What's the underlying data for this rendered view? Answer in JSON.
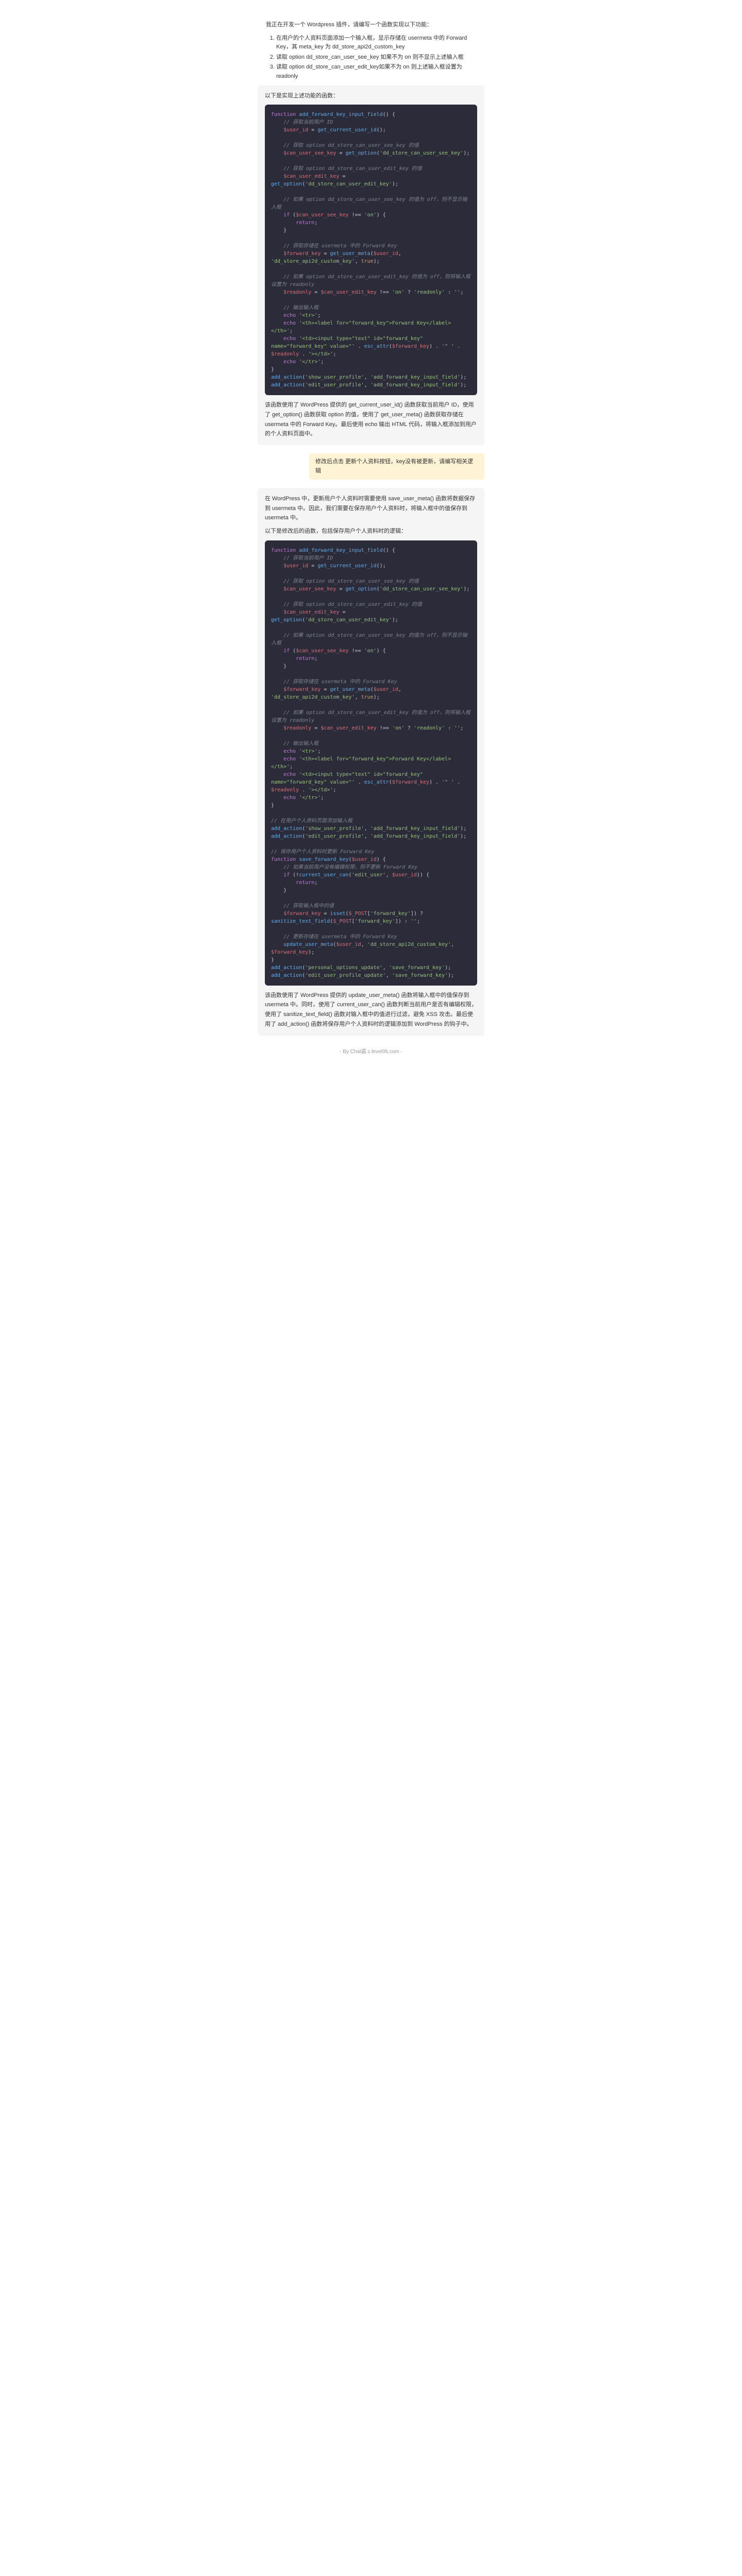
{
  "intro": {
    "title": "我正在开发一个 Wordpress 插件，请编写一个函数实现以下功能：",
    "items": [
      "在用户的个人资料页面添加一个输入框，显示存储在 usermeta 中的 Forward Key，其 meta_key 为 dd_store_api2d_custom_key",
      "读取 option dd_store_can_user_see_key 如果不为 on 则不显示上述输入框",
      "读取 option dd_store_can_user_edit_key如果不为 on 则上述输入框设置为 readonly"
    ]
  },
  "block1": {
    "title": "以下是实现上述功能的函数：",
    "after": "该函数使用了 WordPress 提供的 get_current_user_id() 函数获取当前用户 ID，使用了 get_option() 函数获取 option 的值，使用了 get_user_meta() 函数获取存储在 usermeta 中的 Forward Key。最后使用 echo 输出 HTML 代码，将输入框添加到用户的个人资料页面中。"
  },
  "prompt2": "修改后点击 更新个人资料按钮，key没有被更新，请编写相关逻辑",
  "block2": {
    "pre": "在 WordPress 中，更新用户个人资料时需要使用 save_user_meta() 函数将数据保存到 usermeta 中。因此，我们需要在保存用户个人资料时，将输入框中的值保存到 usermeta 中。",
    "pre2": "以下是修改后的函数，包括保存用户个人资料时的逻辑：",
    "after": "该函数使用了 WordPress 提供的 update_user_meta() 函数将输入框中的值保存到 usermeta 中。同时，使用了 current_user_can() 函数判断当前用户是否有编辑权限，使用了 sanitize_text_field() 函数对输入框中的值进行过滤，避免 XSS 攻击。最后使用了 add_action() 函数将保存用户个人资料时的逻辑添加到 WordPress 的钩子中。"
  },
  "footer": "- By Chat酱 c.level06.com -",
  "code1_lines": [
    {
      "t": "kw",
      "v": "function"
    },
    {
      "t": "plain",
      "v": " "
    },
    {
      "t": "fn",
      "v": "add_forward_key_input_field"
    },
    {
      "t": "plain",
      "v": "() {"
    },
    "\n    ",
    {
      "t": "cm",
      "v": "// 获取当前用户 ID"
    },
    "\n    ",
    {
      "t": "var",
      "v": "$user_id"
    },
    {
      "t": "plain",
      "v": " = "
    },
    {
      "t": "fn",
      "v": "get_current_user_id"
    },
    {
      "t": "plain",
      "v": "();"
    },
    "\n",
    "\n    ",
    {
      "t": "cm",
      "v": "// 获取 option dd_store_can_user_see_key 的值"
    },
    "\n    ",
    {
      "t": "var",
      "v": "$can_user_see_key"
    },
    {
      "t": "plain",
      "v": " = "
    },
    {
      "t": "fn",
      "v": "get_option"
    },
    {
      "t": "plain",
      "v": "("
    },
    {
      "t": "str",
      "v": "'dd_store_can_user_see_key'"
    },
    {
      "t": "plain",
      "v": ");"
    },
    "\n",
    "\n    ",
    {
      "t": "cm",
      "v": "// 获取 option dd_store_can_user_edit_key 的值"
    },
    "\n    ",
    {
      "t": "var",
      "v": "$can_user_edit_key"
    },
    {
      "t": "plain",
      "v": " = "
    },
    {
      "t": "fn",
      "v": "get_option"
    },
    {
      "t": "plain",
      "v": "("
    },
    {
      "t": "str",
      "v": "'dd_store_can_user_edit_key'"
    },
    {
      "t": "plain",
      "v": ");"
    },
    "\n",
    "\n    ",
    {
      "t": "cm",
      "v": "// 如果 option dd_store_can_user_see_key 的值为 off，则不显示输入框"
    },
    "\n    ",
    {
      "t": "kw",
      "v": "if"
    },
    {
      "t": "plain",
      "v": " ("
    },
    {
      "t": "var",
      "v": "$can_user_see_key"
    },
    {
      "t": "plain",
      "v": " !== "
    },
    {
      "t": "str",
      "v": "'on'"
    },
    {
      "t": "plain",
      "v": ") {"
    },
    "\n        ",
    {
      "t": "kw",
      "v": "return"
    },
    {
      "t": "plain",
      "v": ";"
    },
    "\n    ",
    {
      "t": "plain",
      "v": "}"
    },
    "\n",
    "\n    ",
    {
      "t": "cm",
      "v": "// 获取存储在 usermeta 中的 Forward Key"
    },
    "\n    ",
    {
      "t": "var",
      "v": "$forward_key"
    },
    {
      "t": "plain",
      "v": " = "
    },
    {
      "t": "fn",
      "v": "get_user_meta"
    },
    {
      "t": "plain",
      "v": "("
    },
    {
      "t": "var",
      "v": "$user_id"
    },
    {
      "t": "plain",
      "v": ", "
    },
    {
      "t": "str",
      "v": "'dd_store_api2d_custom_key'"
    },
    {
      "t": "plain",
      "v": ", "
    },
    {
      "t": "bool",
      "v": "true"
    },
    {
      "t": "plain",
      "v": ");"
    },
    "\n",
    "\n    ",
    {
      "t": "cm",
      "v": "// 如果 option dd_store_can_user_edit_key 的值为 off，则将输入框设置为 readonly"
    },
    "\n    ",
    {
      "t": "var",
      "v": "$readonly"
    },
    {
      "t": "plain",
      "v": " = "
    },
    {
      "t": "var",
      "v": "$can_user_edit_key"
    },
    {
      "t": "plain",
      "v": " !== "
    },
    {
      "t": "str",
      "v": "'on'"
    },
    {
      "t": "plain",
      "v": " ? "
    },
    {
      "t": "str",
      "v": "'readonly'"
    },
    {
      "t": "plain",
      "v": " : "
    },
    {
      "t": "str",
      "v": "''"
    },
    {
      "t": "plain",
      "v": ";"
    },
    "\n",
    "\n    ",
    {
      "t": "cm",
      "v": "// 输出输入框"
    },
    "\n    ",
    {
      "t": "kw",
      "v": "echo"
    },
    {
      "t": "plain",
      "v": " "
    },
    {
      "t": "str",
      "v": "'<tr>'"
    },
    {
      "t": "plain",
      "v": ";"
    },
    "\n    ",
    {
      "t": "kw",
      "v": "echo"
    },
    {
      "t": "plain",
      "v": " "
    },
    {
      "t": "str",
      "v": "'<th><label for=\"forward_key\">Forward Key</label></th>'"
    },
    {
      "t": "plain",
      "v": ";"
    },
    "\n    ",
    {
      "t": "kw",
      "v": "echo"
    },
    {
      "t": "plain",
      "v": " "
    },
    {
      "t": "str",
      "v": "'<td><input type=\"text\" id=\"forward_key\" name=\"forward_key\" value=\"'"
    },
    {
      "t": "plain",
      "v": " . "
    },
    {
      "t": "fn",
      "v": "esc_attr"
    },
    {
      "t": "plain",
      "v": "("
    },
    {
      "t": "var",
      "v": "$forward_key"
    },
    {
      "t": "plain",
      "v": ") . "
    },
    {
      "t": "str",
      "v": "'\" '"
    },
    {
      "t": "plain",
      "v": " . "
    },
    {
      "t": "var",
      "v": "$readonly"
    },
    {
      "t": "plain",
      "v": " . "
    },
    {
      "t": "str",
      "v": "'></td>'"
    },
    {
      "t": "plain",
      "v": ";"
    },
    "\n    ",
    {
      "t": "kw",
      "v": "echo"
    },
    {
      "t": "plain",
      "v": " "
    },
    {
      "t": "str",
      "v": "'</tr>'"
    },
    {
      "t": "plain",
      "v": ";"
    },
    "\n",
    {
      "t": "plain",
      "v": "}"
    },
    "\n",
    {
      "t": "fn",
      "v": "add_action"
    },
    {
      "t": "plain",
      "v": "("
    },
    {
      "t": "str",
      "v": "'show_user_profile'"
    },
    {
      "t": "plain",
      "v": ", "
    },
    {
      "t": "str",
      "v": "'add_forward_key_input_field'"
    },
    {
      "t": "plain",
      "v": ");"
    },
    "\n",
    {
      "t": "fn",
      "v": "add_action"
    },
    {
      "t": "plain",
      "v": "("
    },
    {
      "t": "str",
      "v": "'edit_user_profile'"
    },
    {
      "t": "plain",
      "v": ", "
    },
    {
      "t": "str",
      "v": "'add_forward_key_input_field'"
    },
    {
      "t": "plain",
      "v": ");"
    }
  ],
  "code2_lines": [
    {
      "t": "kw",
      "v": "function"
    },
    {
      "t": "plain",
      "v": " "
    },
    {
      "t": "fn",
      "v": "add_forward_key_input_field"
    },
    {
      "t": "plain",
      "v": "() {"
    },
    "\n    ",
    {
      "t": "cm",
      "v": "// 获取当前用户 ID"
    },
    "\n    ",
    {
      "t": "var",
      "v": "$user_id"
    },
    {
      "t": "plain",
      "v": " = "
    },
    {
      "t": "fn",
      "v": "get_current_user_id"
    },
    {
      "t": "plain",
      "v": "();"
    },
    "\n",
    "\n    ",
    {
      "t": "cm",
      "v": "// 获取 option dd_store_can_user_see_key 的值"
    },
    "\n    ",
    {
      "t": "var",
      "v": "$can_user_see_key"
    },
    {
      "t": "plain",
      "v": " = "
    },
    {
      "t": "fn",
      "v": "get_option"
    },
    {
      "t": "plain",
      "v": "("
    },
    {
      "t": "str",
      "v": "'dd_store_can_user_see_key'"
    },
    {
      "t": "plain",
      "v": ");"
    },
    "\n",
    "\n    ",
    {
      "t": "cm",
      "v": "// 获取 option dd_store_can_user_edit_key 的值"
    },
    "\n    ",
    {
      "t": "var",
      "v": "$can_user_edit_key"
    },
    {
      "t": "plain",
      "v": " = "
    },
    {
      "t": "fn",
      "v": "get_option"
    },
    {
      "t": "plain",
      "v": "("
    },
    {
      "t": "str",
      "v": "'dd_store_can_user_edit_key'"
    },
    {
      "t": "plain",
      "v": ");"
    },
    "\n",
    "\n    ",
    {
      "t": "cm",
      "v": "// 如果 option dd_store_can_user_see_key 的值为 off，则不显示输入框"
    },
    "\n    ",
    {
      "t": "kw",
      "v": "if"
    },
    {
      "t": "plain",
      "v": " ("
    },
    {
      "t": "var",
      "v": "$can_user_see_key"
    },
    {
      "t": "plain",
      "v": " !== "
    },
    {
      "t": "str",
      "v": "'on'"
    },
    {
      "t": "plain",
      "v": ") {"
    },
    "\n        ",
    {
      "t": "kw",
      "v": "return"
    },
    {
      "t": "plain",
      "v": ";"
    },
    "\n    ",
    {
      "t": "plain",
      "v": "}"
    },
    "\n",
    "\n    ",
    {
      "t": "cm",
      "v": "// 获取存储在 usermeta 中的 Forward Key"
    },
    "\n    ",
    {
      "t": "var",
      "v": "$forward_key"
    },
    {
      "t": "plain",
      "v": " = "
    },
    {
      "t": "fn",
      "v": "get_user_meta"
    },
    {
      "t": "plain",
      "v": "("
    },
    {
      "t": "var",
      "v": "$user_id"
    },
    {
      "t": "plain",
      "v": ", "
    },
    {
      "t": "str",
      "v": "'dd_store_api2d_custom_key'"
    },
    {
      "t": "plain",
      "v": ", "
    },
    {
      "t": "bool",
      "v": "true"
    },
    {
      "t": "plain",
      "v": ");"
    },
    "\n",
    "\n    ",
    {
      "t": "cm",
      "v": "// 如果 option dd_store_can_user_edit_key 的值为 off，则将输入框设置为 readonly"
    },
    "\n    ",
    {
      "t": "var",
      "v": "$readonly"
    },
    {
      "t": "plain",
      "v": " = "
    },
    {
      "t": "var",
      "v": "$can_user_edit_key"
    },
    {
      "t": "plain",
      "v": " !== "
    },
    {
      "t": "str",
      "v": "'on'"
    },
    {
      "t": "plain",
      "v": " ? "
    },
    {
      "t": "str",
      "v": "'readonly'"
    },
    {
      "t": "plain",
      "v": " : "
    },
    {
      "t": "str",
      "v": "''"
    },
    {
      "t": "plain",
      "v": ";"
    },
    "\n",
    "\n    ",
    {
      "t": "cm",
      "v": "// 输出输入框"
    },
    "\n    ",
    {
      "t": "kw",
      "v": "echo"
    },
    {
      "t": "plain",
      "v": " "
    },
    {
      "t": "str",
      "v": "'<tr>'"
    },
    {
      "t": "plain",
      "v": ";"
    },
    "\n    ",
    {
      "t": "kw",
      "v": "echo"
    },
    {
      "t": "plain",
      "v": " "
    },
    {
      "t": "str",
      "v": "'<th><label for=\"forward_key\">Forward Key</label></th>'"
    },
    {
      "t": "plain",
      "v": ";"
    },
    "\n    ",
    {
      "t": "kw",
      "v": "echo"
    },
    {
      "t": "plain",
      "v": " "
    },
    {
      "t": "str",
      "v": "'<td><input type=\"text\" id=\"forward_key\" name=\"forward_key\" value=\"'"
    },
    {
      "t": "plain",
      "v": " . "
    },
    {
      "t": "fn",
      "v": "esc_attr"
    },
    {
      "t": "plain",
      "v": "("
    },
    {
      "t": "var",
      "v": "$forward_key"
    },
    {
      "t": "plain",
      "v": ") . "
    },
    {
      "t": "str",
      "v": "'\" '"
    },
    {
      "t": "plain",
      "v": " . "
    },
    {
      "t": "var",
      "v": "$readonly"
    },
    {
      "t": "plain",
      "v": " . "
    },
    {
      "t": "str",
      "v": "'></td>'"
    },
    {
      "t": "plain",
      "v": ";"
    },
    "\n    ",
    {
      "t": "kw",
      "v": "echo"
    },
    {
      "t": "plain",
      "v": " "
    },
    {
      "t": "str",
      "v": "'</tr>'"
    },
    {
      "t": "plain",
      "v": ";"
    },
    "\n",
    {
      "t": "plain",
      "v": "}"
    },
    "\n",
    "\n",
    {
      "t": "cm",
      "v": "// 在用户个人资料页面添加输入框"
    },
    "\n",
    {
      "t": "fn",
      "v": "add_action"
    },
    {
      "t": "plain",
      "v": "("
    },
    {
      "t": "str",
      "v": "'show_user_profile'"
    },
    {
      "t": "plain",
      "v": ", "
    },
    {
      "t": "str",
      "v": "'add_forward_key_input_field'"
    },
    {
      "t": "plain",
      "v": ");"
    },
    "\n",
    {
      "t": "fn",
      "v": "add_action"
    },
    {
      "t": "plain",
      "v": "("
    },
    {
      "t": "str",
      "v": "'edit_user_profile'"
    },
    {
      "t": "plain",
      "v": ", "
    },
    {
      "t": "str",
      "v": "'add_forward_key_input_field'"
    },
    {
      "t": "plain",
      "v": ");"
    },
    "\n",
    "\n",
    {
      "t": "cm",
      "v": "// 保存用户个人资料时更新 Forward Key"
    },
    "\n",
    {
      "t": "kw",
      "v": "function"
    },
    {
      "t": "plain",
      "v": " "
    },
    {
      "t": "fn",
      "v": "save_forward_key"
    },
    {
      "t": "plain",
      "v": "("
    },
    {
      "t": "var",
      "v": "$user_id"
    },
    {
      "t": "plain",
      "v": ") {"
    },
    "\n    ",
    {
      "t": "cm",
      "v": "// 如果当前用户没有编辑权限，则不更新 Forward Key"
    },
    "\n    ",
    {
      "t": "kw",
      "v": "if"
    },
    {
      "t": "plain",
      "v": " (!"
    },
    {
      "t": "fn",
      "v": "current_user_can"
    },
    {
      "t": "plain",
      "v": "("
    },
    {
      "t": "str",
      "v": "'edit_user'"
    },
    {
      "t": "plain",
      "v": ", "
    },
    {
      "t": "var",
      "v": "$user_id"
    },
    {
      "t": "plain",
      "v": ")) {"
    },
    "\n        ",
    {
      "t": "kw",
      "v": "return"
    },
    {
      "t": "plain",
      "v": ";"
    },
    "\n    ",
    {
      "t": "plain",
      "v": "}"
    },
    "\n",
    "\n    ",
    {
      "t": "cm",
      "v": "// 获取输入框中的值"
    },
    "\n    ",
    {
      "t": "var",
      "v": "$forward_key"
    },
    {
      "t": "plain",
      "v": " = "
    },
    {
      "t": "fn",
      "v": "isset"
    },
    {
      "t": "plain",
      "v": "("
    },
    {
      "t": "var",
      "v": "$_POST"
    },
    {
      "t": "plain",
      "v": "["
    },
    {
      "t": "str",
      "v": "'forward_key'"
    },
    {
      "t": "plain",
      "v": "]) ? "
    },
    {
      "t": "fn",
      "v": "sanitize_text_field"
    },
    {
      "t": "plain",
      "v": "("
    },
    {
      "t": "var",
      "v": "$_POST"
    },
    {
      "t": "plain",
      "v": "["
    },
    {
      "t": "str",
      "v": "'forward_key'"
    },
    {
      "t": "plain",
      "v": "]) : "
    },
    {
      "t": "str",
      "v": "''"
    },
    {
      "t": "plain",
      "v": ";"
    },
    "\n",
    "\n    ",
    {
      "t": "cm",
      "v": "// 更新存储在 usermeta 中的 Forward Key"
    },
    "\n    ",
    {
      "t": "fn",
      "v": "update_user_meta"
    },
    {
      "t": "plain",
      "v": "("
    },
    {
      "t": "var",
      "v": "$user_id"
    },
    {
      "t": "plain",
      "v": ", "
    },
    {
      "t": "str",
      "v": "'dd_store_api2d_custom_key'"
    },
    {
      "t": "plain",
      "v": ", "
    },
    {
      "t": "var",
      "v": "$forward_key"
    },
    {
      "t": "plain",
      "v": ");"
    },
    "\n",
    {
      "t": "plain",
      "v": "}"
    },
    "\n",
    {
      "t": "fn",
      "v": "add_action"
    },
    {
      "t": "plain",
      "v": "("
    },
    {
      "t": "str",
      "v": "'personal_options_update'"
    },
    {
      "t": "plain",
      "v": ", "
    },
    {
      "t": "str",
      "v": "'save_forward_key'"
    },
    {
      "t": "plain",
      "v": ");"
    },
    "\n",
    {
      "t": "fn",
      "v": "add_action"
    },
    {
      "t": "plain",
      "v": "("
    },
    {
      "t": "str",
      "v": "'edit_user_profile_update'"
    },
    {
      "t": "plain",
      "v": ", "
    },
    {
      "t": "str",
      "v": "'save_forward_key'"
    },
    {
      "t": "plain",
      "v": ");"
    }
  ]
}
